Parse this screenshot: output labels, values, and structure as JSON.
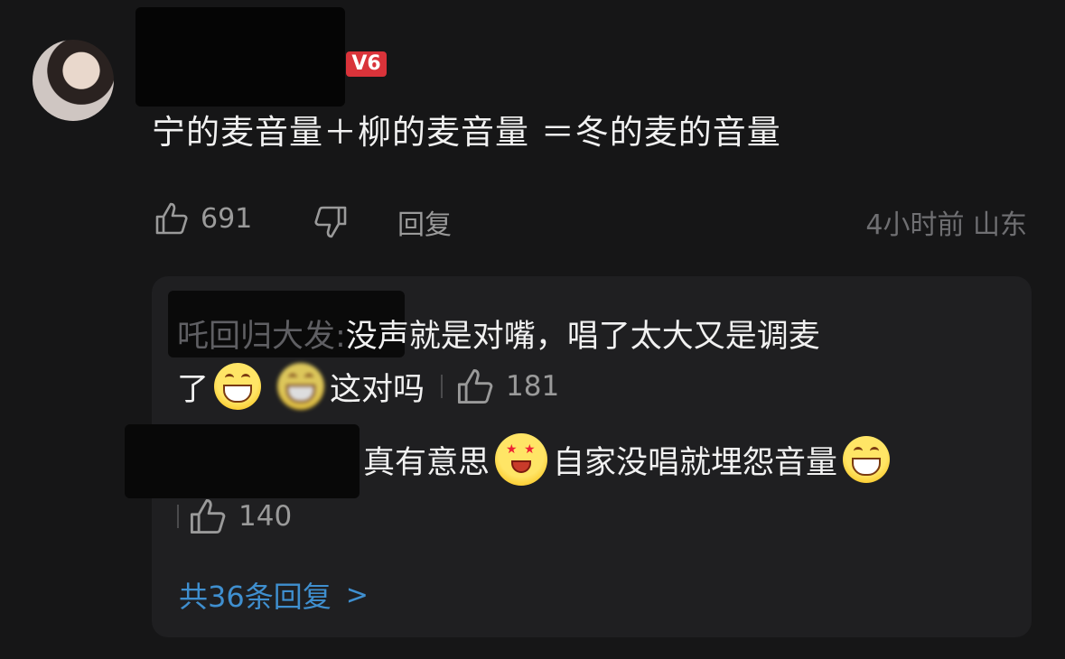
{
  "comment": {
    "badge": "V6",
    "text": "宁的麦音量＋柳的麦音量 ＝冬的麦的音量",
    "likes": "691",
    "reply_label": "回复",
    "time_location": "4小时前 山东"
  },
  "replies": [
    {
      "user": "吒回归大发:",
      "text_line1": "没声就是对嘴，唱了太大又是调麦",
      "text_line2_start": "了",
      "text_line2_end": "这对吗",
      "likes": "181"
    },
    {
      "text_a": "真有意思",
      "text_b": "自家没唱就埋怨音量",
      "likes": "140"
    }
  ],
  "more_replies": {
    "label": "共36条回复",
    "chevron": ">"
  },
  "colors": {
    "background": "#161617",
    "reply_background": "#1f1f21",
    "link_blue": "#3f8fcf",
    "badge_red": "#d9333a"
  },
  "icons": [
    "thumb-up-icon",
    "thumb-down-icon",
    "grin-emoji",
    "star-eyes-emoji",
    "chevron-right-icon"
  ]
}
